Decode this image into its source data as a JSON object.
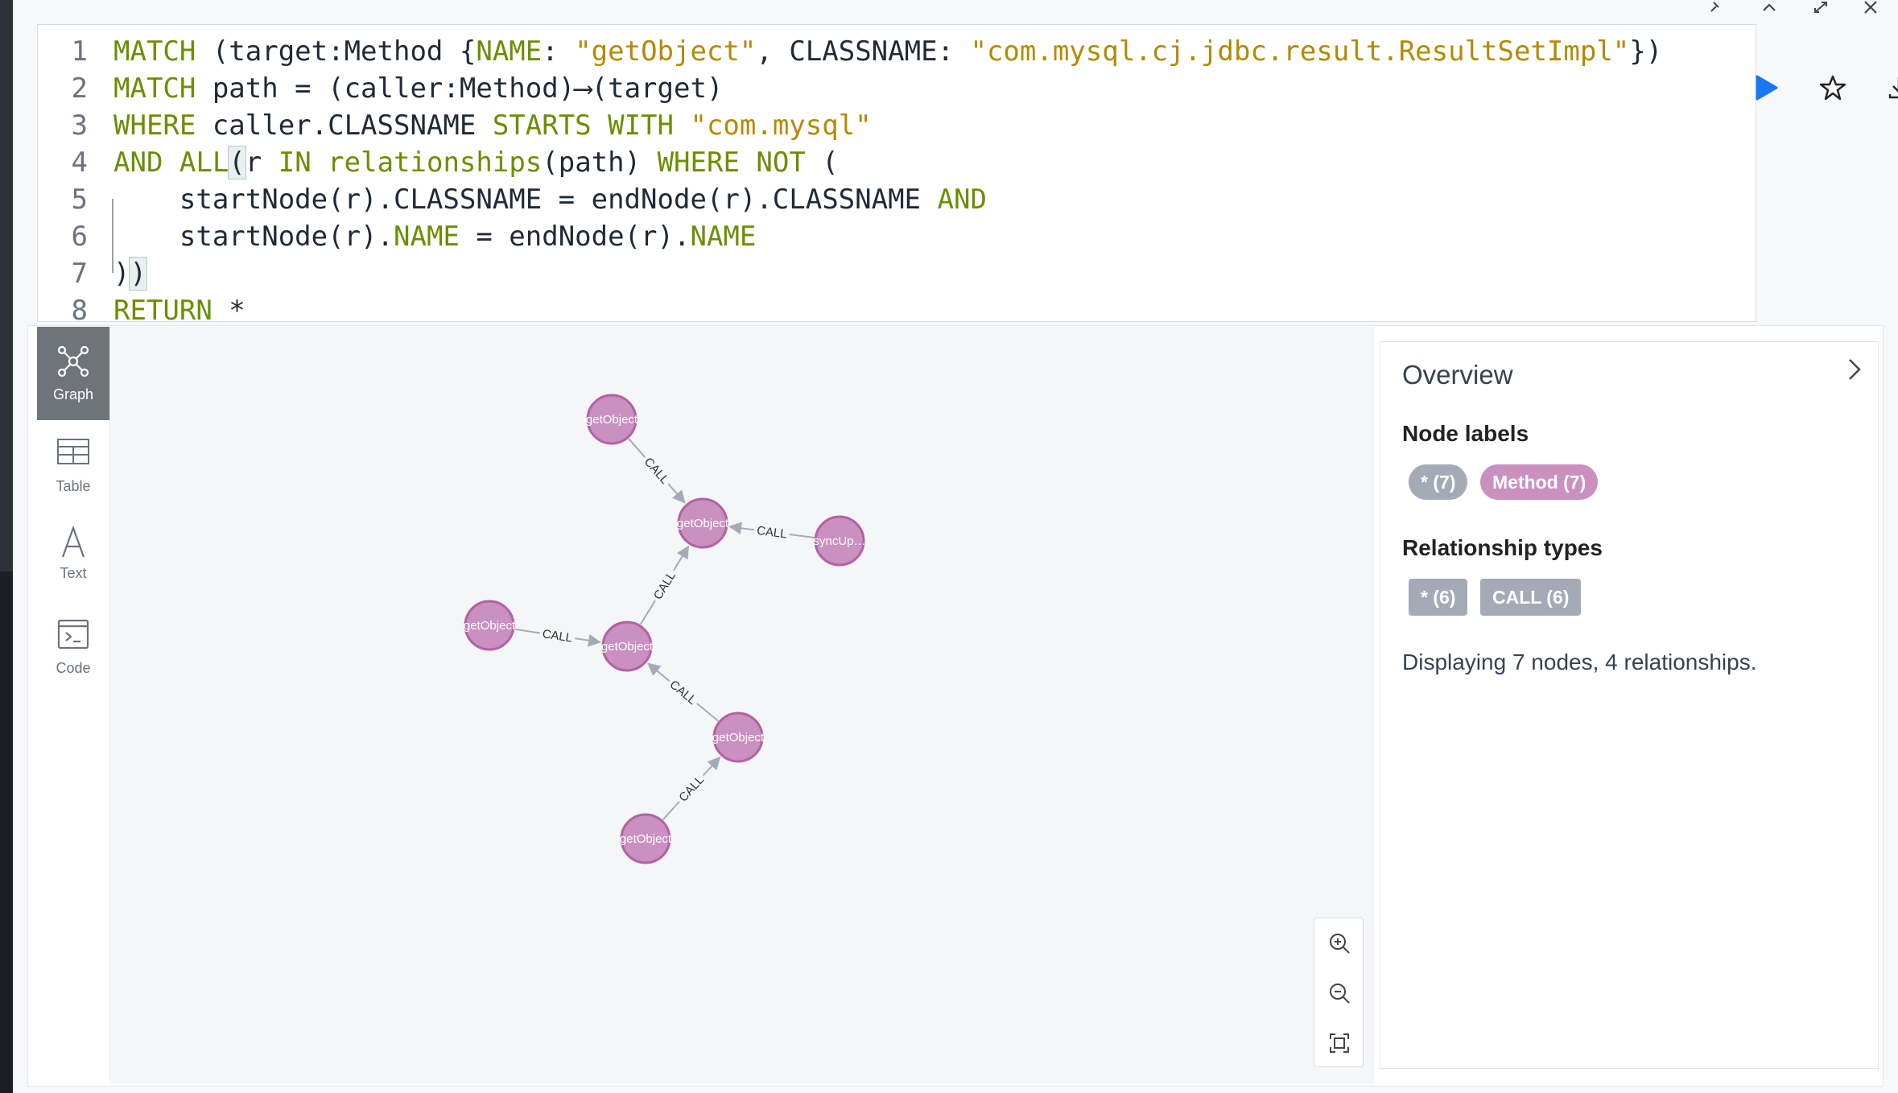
{
  "window_controls": [
    "pin-icon",
    "collapse-icon",
    "expand-icon",
    "close-icon"
  ],
  "editor": {
    "lines": [
      {
        "n": "1",
        "segments": [
          {
            "t": "MATCH",
            "c": "kw"
          },
          {
            "t": " (target:Method {",
            "c": ""
          },
          {
            "t": "NAME",
            "c": "kw"
          },
          {
            "t": ": ",
            "c": ""
          },
          {
            "t": "\"getObject\"",
            "c": "str"
          },
          {
            "t": ", CLASSNAME: ",
            "c": ""
          },
          {
            "t": "\"com.mysql.cj.jdbc.result.ResultSetImpl\"",
            "c": "str"
          },
          {
            "t": "})",
            "c": ""
          }
        ]
      },
      {
        "n": "2",
        "segments": [
          {
            "t": "MATCH",
            "c": "kw"
          },
          {
            "t": " path = (caller:Method)⟶(target)",
            "c": ""
          }
        ]
      },
      {
        "n": "3",
        "segments": [
          {
            "t": "WHERE",
            "c": "kw"
          },
          {
            "t": " caller.CLASSNAME ",
            "c": ""
          },
          {
            "t": "STARTS WITH",
            "c": "kw"
          },
          {
            "t": " ",
            "c": ""
          },
          {
            "t": "\"com.mysql\"",
            "c": "str"
          }
        ]
      },
      {
        "n": "4",
        "segments": [
          {
            "t": "AND ALL",
            "c": "kw"
          },
          {
            "t": "(",
            "c": "br"
          },
          {
            "t": "r ",
            "c": ""
          },
          {
            "t": "IN",
            "c": "kw"
          },
          {
            "t": " ",
            "c": ""
          },
          {
            "t": "relationships",
            "c": "fn"
          },
          {
            "t": "(path) ",
            "c": ""
          },
          {
            "t": "WHERE NOT",
            "c": "kw"
          },
          {
            "t": " (",
            "c": ""
          }
        ]
      },
      {
        "n": "5",
        "segments": [
          {
            "t": "    startNode(r).CLASSNAME = endNode(r).CLASSNAME ",
            "c": ""
          },
          {
            "t": "AND",
            "c": "kw"
          }
        ]
      },
      {
        "n": "6",
        "segments": [
          {
            "t": "    startNode(r).",
            "c": ""
          },
          {
            "t": "NAME",
            "c": "kw"
          },
          {
            "t": " = endNode(r).",
            "c": ""
          },
          {
            "t": "NAME",
            "c": "kw"
          }
        ]
      },
      {
        "n": "7",
        "segments": [
          {
            "t": ")",
            "c": ""
          },
          {
            "t": ")",
            "c": "br"
          }
        ]
      },
      {
        "n": "8",
        "segments": [
          {
            "t": "RETURN",
            "c": "kw"
          },
          {
            "t": " *",
            "c": ""
          }
        ]
      }
    ]
  },
  "sidebar": {
    "items": [
      {
        "label": "Graph",
        "icon": "graph-icon",
        "active": true
      },
      {
        "label": "Table",
        "icon": "table-icon",
        "active": false
      },
      {
        "label": "Text",
        "icon": "text-icon",
        "active": false
      },
      {
        "label": "Code",
        "icon": "code-icon",
        "active": false
      }
    ]
  },
  "graph": {
    "node_color": "#c990c0",
    "node_stroke": "#b261a5",
    "nodes": [
      {
        "id": "n1",
        "caption": "getObject"
      },
      {
        "id": "n2",
        "caption": "getObject"
      },
      {
        "id": "n3",
        "caption": "syncUp…"
      },
      {
        "id": "n4",
        "caption": "getObject"
      },
      {
        "id": "n5",
        "caption": "getObject"
      },
      {
        "id": "n6",
        "caption": "getObject"
      },
      {
        "id": "n7",
        "caption": "getObject"
      }
    ],
    "relationships": [
      {
        "from": "n1",
        "to": "n2",
        "type": "CALL"
      },
      {
        "from": "n3",
        "to": "n2",
        "type": "CALL"
      },
      {
        "from": "n5",
        "to": "n2",
        "type": "CALL"
      },
      {
        "from": "n4",
        "to": "n5",
        "type": "CALL"
      },
      {
        "from": "n6",
        "to": "n5",
        "type": "CALL"
      },
      {
        "from": "n7",
        "to": "n6",
        "type": "CALL"
      }
    ]
  },
  "zoom_controls": [
    "zoom-in-icon",
    "zoom-out-icon",
    "fit-icon"
  ],
  "overview": {
    "title": "Overview",
    "node_labels_heading": "Node labels",
    "node_labels": [
      {
        "text": "* (7)",
        "color": "#a5abb6"
      },
      {
        "text": "Method (7)",
        "color": "#c990c0"
      }
    ],
    "rel_types_heading": "Relationship types",
    "rel_types": [
      {
        "text": "* (6)",
        "color": "#a5abb6"
      },
      {
        "text": "CALL (6)",
        "color": "#a5abb6"
      }
    ],
    "status": "Displaying 7 nodes, 4 relationships."
  }
}
